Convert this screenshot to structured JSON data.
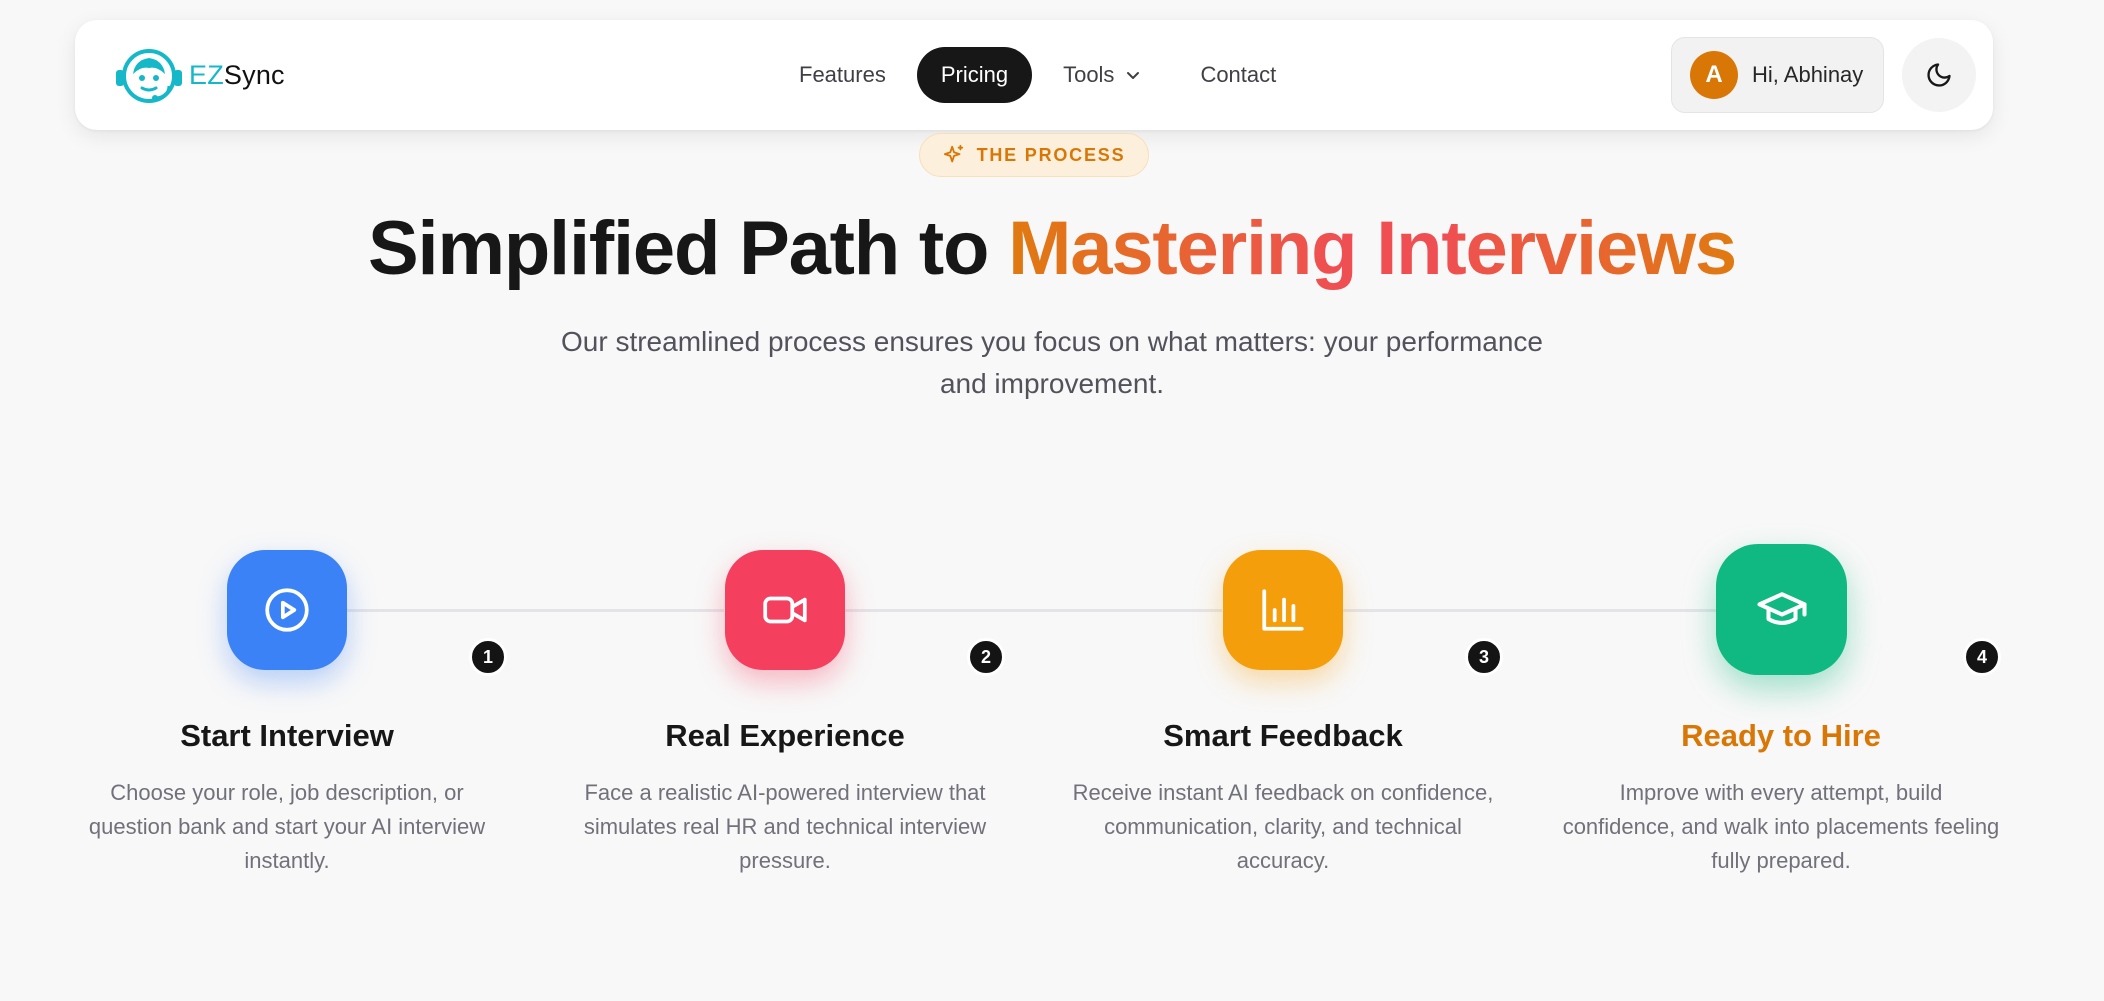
{
  "nav": {
    "logo_prefix": "EZ",
    "logo_suffix": "Sync",
    "links": [
      {
        "label": "Features"
      },
      {
        "label": "Pricing",
        "active": true
      },
      {
        "label": "Tools",
        "has_dropdown": true
      },
      {
        "label": "Contact"
      }
    ],
    "user": {
      "initial": "A",
      "greeting": "Hi, Abhinay"
    },
    "theme_toggle_icon": "moon-icon"
  },
  "hero": {
    "badge": "THE PROCESS",
    "title_plain": "Simplified Path to ",
    "title_highlight": "Mastering Interviews",
    "subtitle": "Our streamlined process ensures you focus on what matters: your performance and improvement."
  },
  "steps": [
    {
      "number": "1",
      "icon": "play-circle-icon",
      "color": "#3b82f6",
      "title": "Start Interview",
      "description": "Choose your role, job description, or question bank and start your AI interview instantly."
    },
    {
      "number": "2",
      "icon": "video-camera-icon",
      "color": "#f43f5e",
      "title": "Real Experience",
      "description": "Face a realistic AI-powered interview that simulates real HR and technical interview pressure."
    },
    {
      "number": "3",
      "icon": "bar-chart-icon",
      "color": "#f59e0b",
      "title": "Smart Feedback",
      "description": "Receive instant AI feedback on confidence, communication, clarity, and technical accuracy."
    },
    {
      "number": "4",
      "icon": "graduation-cap-icon",
      "color": "#10b981",
      "title": "Ready to Hire",
      "description": "Improve with every attempt, build confidence, and walk into placements feeling fully prepared.",
      "highlighted": true
    }
  ],
  "colors": {
    "accent": "#d97706",
    "gradient_start": "#e07a10",
    "gradient_mid": "#ef4f52",
    "dark": "#171717"
  }
}
